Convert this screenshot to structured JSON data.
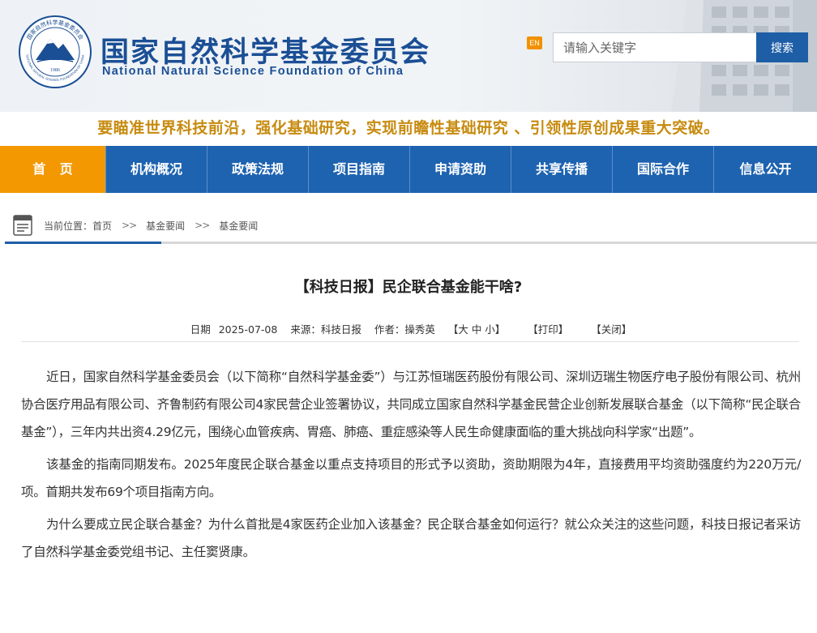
{
  "header": {
    "org_name_cn": "国家自然科学基金委员会",
    "org_name_en": "National Natural Science Foundation of China",
    "seal_text_top": "国家自然科学基金委员会",
    "seal_text_bottom": "NATIONAL NATURAL SCIENCE FOUNDATION OF CHINA",
    "seal_year": "1986",
    "lang_switch": "EN",
    "search_placeholder": "请输入关键字",
    "search_button": "搜索"
  },
  "slogan": "要瞄准世界科技前沿，强化基础研究，实现前瞻性基础研究 、引领性原创成果重大突破。",
  "nav": {
    "items": [
      "首 页",
      "机构概况",
      "政策法规",
      "项目指南",
      "申请资助",
      "共享传播",
      "国际合作",
      "信息公开"
    ],
    "active_index": 0
  },
  "breadcrumb": {
    "prefix": "当前位置：",
    "items": [
      "首页",
      "基金要闻",
      "基金要闻"
    ],
    "separator": ">>"
  },
  "article": {
    "title": "【科技日报】民企联合基金能干啥?",
    "date_label": "日期",
    "date": "2025-07-08",
    "source_label": "来源：",
    "source": "科技日报",
    "author_label": "作者：",
    "author": "操秀英",
    "font_size_ctrl": "【大 中 小】",
    "print": "【打印】",
    "close": "【关闭】",
    "paragraphs": [
      "近日，国家自然科学基金委员会（以下简称“自然科学基金委”）与江苏恒瑞医药股份有限公司、深圳迈瑞生物医疗电子股份有限公司、杭州协合医疗用品有限公司、齐鲁制药有限公司4家民营企业签署协议，共同成立国家自然科学基金民营企业创新发展联合基金（以下简称“民企联合基金”），三年内共出资4.29亿元，围绕心血管疾病、胃癌、肺癌、重症感染等人民生命健康面临的重大挑战向科学家“出题”。",
      "该基金的指南同期发布。2025年度民企联合基金以重点支持项目的形式予以资助，资助期限为4年，直接费用平均资助强度约为220万元/项。首期共发布69个项目指南方向。",
      "为什么要成立民企联合基金？为什么首批是4家医药企业加入该基金？民企联合基金如何运行？就公众关注的这些问题，科技日报记者采访了自然科学基金委党组书记、主任窦贤康。"
    ]
  },
  "colors": {
    "brand_blue": "#1e63b0",
    "nav_active_orange": "#f39800",
    "slogan_gold": "#c78b10",
    "title_blue": "#1b4f95"
  }
}
